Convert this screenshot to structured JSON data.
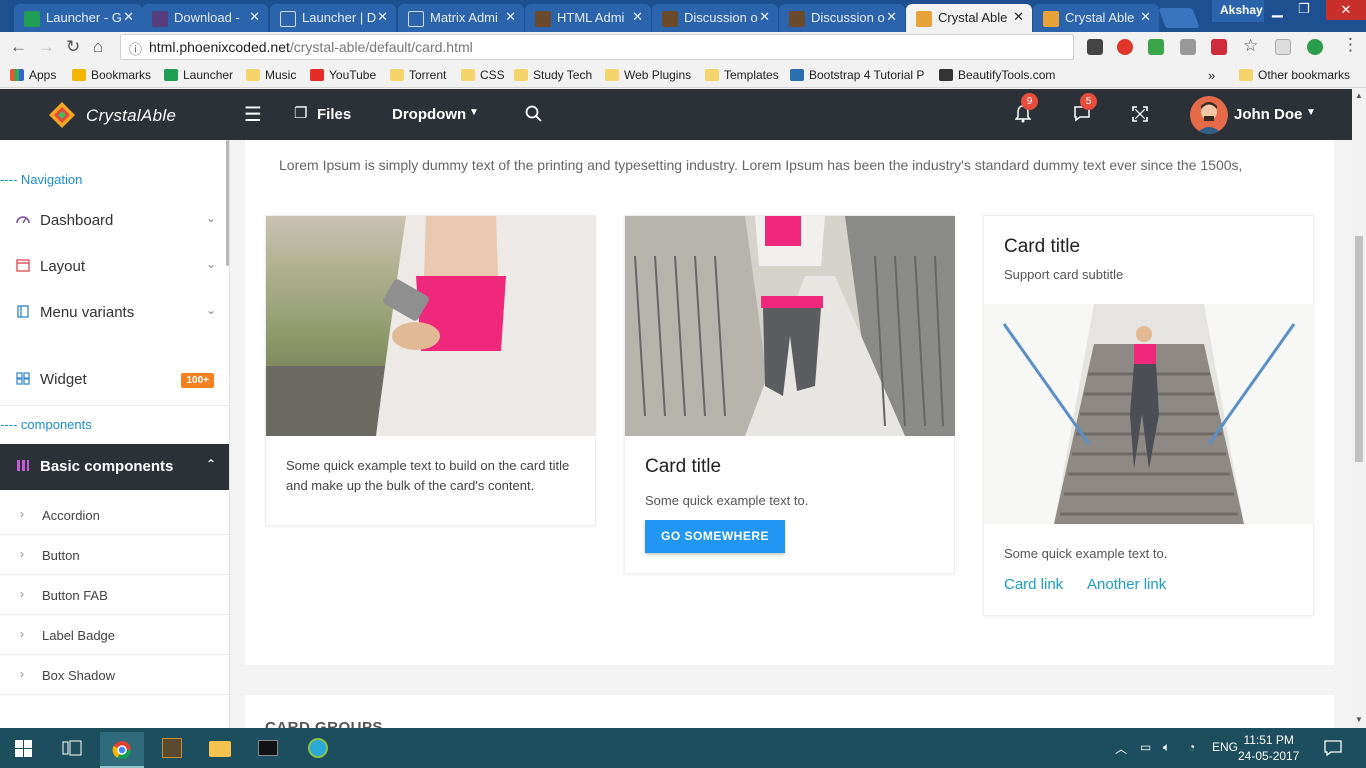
{
  "browser": {
    "tabs": [
      {
        "label": "Launcher - G"
      },
      {
        "label": "Download - "
      },
      {
        "label": "Launcher | D"
      },
      {
        "label": "Matrix Admi"
      },
      {
        "label": "HTML Admi"
      },
      {
        "label": "Discussion o"
      },
      {
        "label": "Discussion o"
      },
      {
        "label": "Crystal Able"
      },
      {
        "label": "Crystal Able"
      }
    ],
    "profile_name": "Akshay",
    "url_host": "html.phoenixcoded.net",
    "url_path": "/crystal-able/default/card.html",
    "bookmarks": [
      {
        "label": "Apps"
      },
      {
        "label": "Bookmarks"
      },
      {
        "label": "Launcher"
      },
      {
        "label": "Music"
      },
      {
        "label": "YouTube"
      },
      {
        "label": "Torrent"
      },
      {
        "label": "CSS"
      },
      {
        "label": "Study Tech"
      },
      {
        "label": "Web Plugins"
      },
      {
        "label": "Templates"
      },
      {
        "label": "Bootstrap 4 Tutorial P"
      },
      {
        "label": "BeautifyTools.com"
      }
    ],
    "bookmarks_more": "»",
    "other_bookmarks": "Other bookmarks"
  },
  "header": {
    "brand": "CrystalAble",
    "files_label": "Files",
    "dropdown_label": "Dropdown",
    "notifications_count": "9",
    "messages_count": "5",
    "user_name": "John Doe"
  },
  "sidebar": {
    "nav_caption": "---- Navigation",
    "items": [
      {
        "label": "Dashboard"
      },
      {
        "label": "Layout"
      },
      {
        "label": "Menu variants"
      }
    ],
    "widget_label": "Widget",
    "widget_badge": "100+",
    "components_caption": "---- components",
    "active_label": "Basic components",
    "subitems": [
      {
        "label": "Accordion"
      },
      {
        "label": "Button"
      },
      {
        "label": "Button FAB"
      },
      {
        "label": "Label Badge"
      },
      {
        "label": "Box Shadow"
      }
    ]
  },
  "main": {
    "intro": "Lorem Ipsum is simply dummy text of the printing and typesetting industry. Lorem Ipsum has been the industry's standard dummy text ever since the 1500s,",
    "card1_text": "Some quick example text to build on the card title and make up the bulk of the card's content.",
    "card2_title": "Card title",
    "card2_text": "Some quick example text to.",
    "card2_button": "GO SOMEWHERE",
    "card3_title": "Card title",
    "card3_subtitle": "Support card subtitle",
    "card3_text": "Some quick example text to.",
    "card3_link1": "Card link",
    "card3_link2": "Another link",
    "section2_title": "CARD GROUPS"
  },
  "taskbar": {
    "language": "ENG",
    "time": "11:51 PM",
    "date": "24-05-2017"
  },
  "colors": {
    "header_bg": "#2c3138",
    "primary": "#2196f3",
    "link": "#1aa0c8",
    "badge_orange": "#f7811f",
    "badge_red": "#e74c3c",
    "caption_blue": "#1a8fd8"
  }
}
